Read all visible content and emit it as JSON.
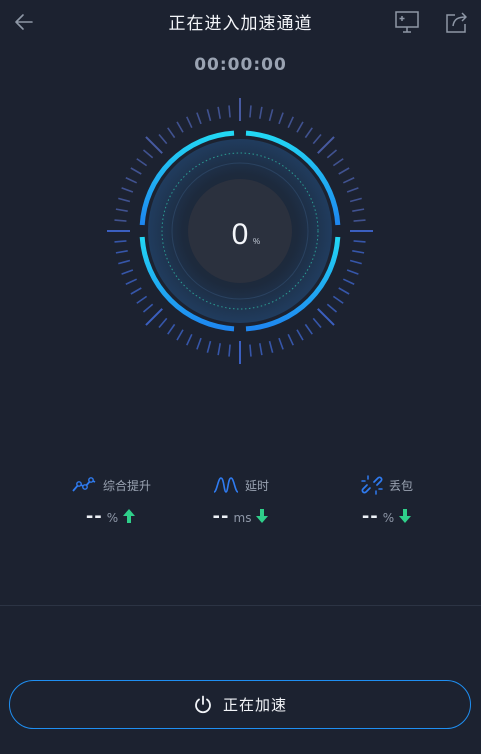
{
  "header": {
    "title": "正在进入加速通道",
    "back_icon": "arrow-left-icon",
    "monitor_icon": "monitor-plus-icon",
    "share_icon": "share-icon"
  },
  "timer": "00:00:00",
  "dial": {
    "value": "0",
    "unit": "%",
    "progress_percent": 0
  },
  "stats": [
    {
      "label": "综合提升",
      "value": "--",
      "unit": "%",
      "icon": "trend-line-icon",
      "arrow": "up",
      "arrow_color": "#2fcf8a"
    },
    {
      "label": "延时",
      "value": "--",
      "unit": "ms",
      "icon": "wave-icon",
      "arrow": "down",
      "arrow_color": "#2fcf8a"
    },
    {
      "label": "丢包",
      "value": "--",
      "unit": "%",
      "icon": "broken-link-icon",
      "arrow": "down",
      "arrow_color": "#2fcf8a"
    }
  ],
  "button": {
    "label": "正在加速",
    "icon": "power-icon"
  },
  "colors": {
    "background": "#1c2230",
    "accent_blue": "#1f8ff2",
    "accent_cyan": "#21d4f2",
    "stat_icon_blue": "#2f7bf0",
    "arrow_green": "#2fcf8a"
  }
}
